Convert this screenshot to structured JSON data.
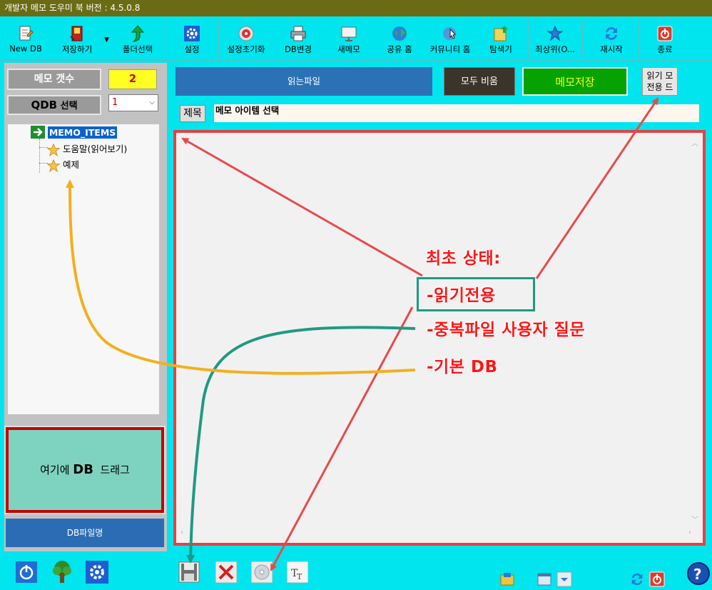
{
  "window": {
    "title": "개발자 메모 도우미 북 버전 : 4.5.0.8"
  },
  "toolbar": {
    "new_db": "New DB",
    "save_as": "저장하기",
    "folder_select": "폴더선택",
    "settings": "설정",
    "reset_settings": "설정초기화",
    "db_change": "DB변경",
    "new_memo": "새메모",
    "share_home": "공유 홈",
    "community_home": "커뮤니티 홈",
    "explorer": "탐색기",
    "topmost": "최상위(O...",
    "restart": "재시작",
    "exit": "종료"
  },
  "left": {
    "memo_count_label": "메모 갯수",
    "memo_count_value": "2",
    "qdb_label_strong": "QDB",
    "qdb_label_rest": " 선택",
    "qdb_selected": "1",
    "tree": {
      "root": "MEMO_ITEMS",
      "items": [
        "도움말(읽어보기)",
        "예제"
      ]
    },
    "drop_zone_prefix": "여기에 ",
    "drop_zone_strong": "DB",
    "drop_zone_suffix": "  드래그",
    "db_filename_button": "DB파일명"
  },
  "main": {
    "read_file_button": "읽는파일",
    "clear_all_button": "모두 비움",
    "save_memo_button": "메모저장",
    "readonly_mode_line1": "읽기 모",
    "readonly_mode_line2": "전용 드",
    "title_label": "제목",
    "title_value": "메모 아이템 선택"
  },
  "annotations": {
    "initial_state": "최초 상태:",
    "read_only": "-읽기전용",
    "duplicate_question": "-중복파일 사용자 질문",
    "default_db": "-기본 DB"
  },
  "colors": {
    "background": "#00E5EE",
    "titlebar": "#6B6B15",
    "annotation_red": "#ff1616",
    "arrow_red": "#e84a4a",
    "arrow_orange": "#f2b01e",
    "arrow_teal": "#1f9a82",
    "save_green": "#04a302"
  }
}
